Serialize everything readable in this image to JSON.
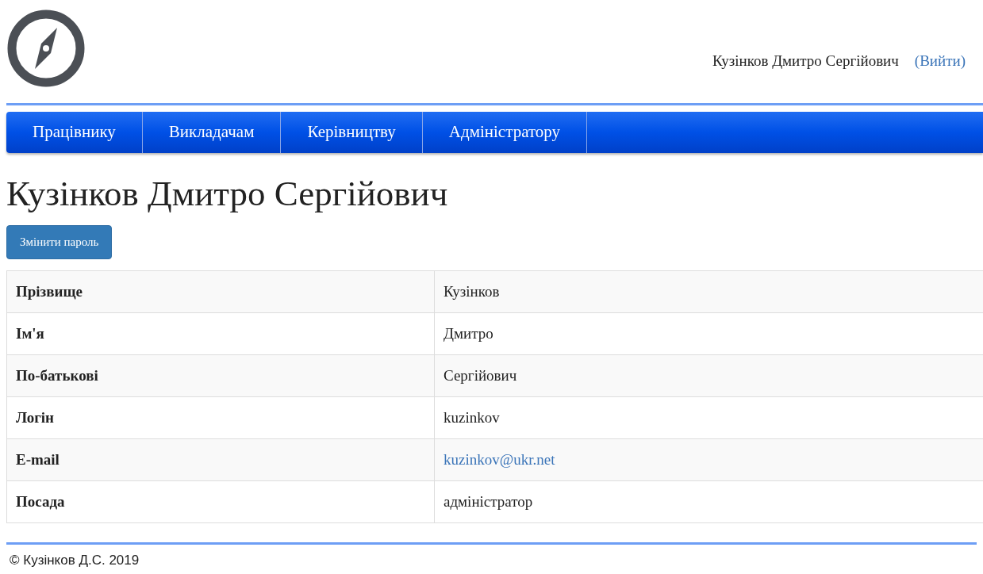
{
  "header": {
    "user_name": "Кузінков Дмитро Сергійович",
    "logout": "(Вийти)"
  },
  "nav": [
    {
      "label": "Працівнику"
    },
    {
      "label": "Викладачам"
    },
    {
      "label": "Керівництву"
    },
    {
      "label": "Адміністратору"
    }
  ],
  "title": "Кузінков Дмитро Сергійович",
  "change_password_button": "Змінити пароль",
  "profile": [
    {
      "label": "Прізвище",
      "value": "Кузінков",
      "kind": "text"
    },
    {
      "label": "Ім'я",
      "value": "Дмитро",
      "kind": "text"
    },
    {
      "label": "По-батькові",
      "value": "Сергійович",
      "kind": "text"
    },
    {
      "label": "Логін",
      "value": "kuzinkov",
      "kind": "text"
    },
    {
      "label": "E-mail",
      "value": "kuzinkov@ukr.net",
      "kind": "link"
    },
    {
      "label": "Посада",
      "value": "адміністратор",
      "kind": "text"
    }
  ],
  "footer": "© Кузінков Д.С. 2019"
}
